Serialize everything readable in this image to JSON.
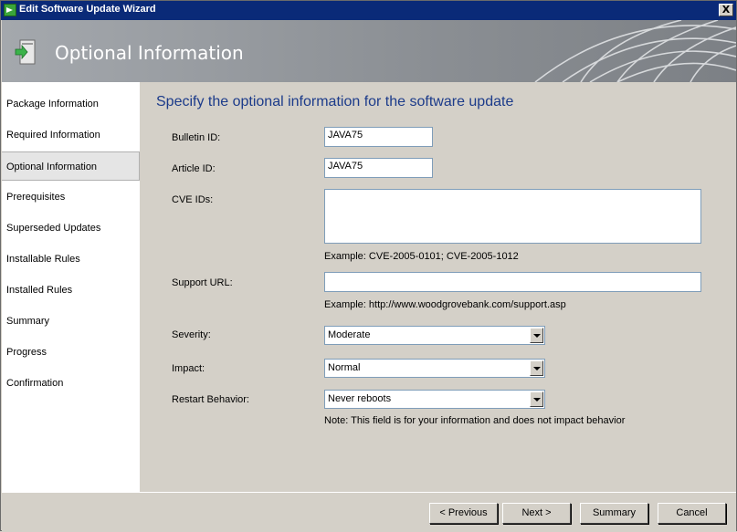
{
  "window": {
    "title": "Edit Software Update Wizard",
    "close_label": "X"
  },
  "banner": {
    "title": "Optional Information"
  },
  "nav": {
    "items": [
      {
        "label": "Package Information"
      },
      {
        "label": "Required Information"
      },
      {
        "label": "Optional Information",
        "active": true
      },
      {
        "label": "Prerequisites"
      },
      {
        "label": "Superseded Updates"
      },
      {
        "label": "Installable Rules"
      },
      {
        "label": "Installed Rules"
      },
      {
        "label": "Summary"
      },
      {
        "label": "Progress"
      },
      {
        "label": "Confirmation"
      }
    ]
  },
  "main": {
    "heading": "Specify the optional information for the software update",
    "bulletin": {
      "label": "Bulletin ID:",
      "value": "JAVA75"
    },
    "article": {
      "label": "Article ID:",
      "value": "JAVA75"
    },
    "cve": {
      "label": "CVE IDs:",
      "value": "",
      "example": "Example: CVE-2005-0101; CVE-2005-1012"
    },
    "support": {
      "label": "Support URL:",
      "value": "",
      "example": "Example: http://www.woodgrovebank.com/support.asp"
    },
    "severity": {
      "label": "Severity:",
      "value": "Moderate"
    },
    "impact": {
      "label": "Impact:",
      "value": "Normal"
    },
    "restart": {
      "label": "Restart Behavior:",
      "value": "Never reboots",
      "note": "Note: This field is for your information and does not impact behavior"
    }
  },
  "footer": {
    "previous": "< Previous",
    "next": "Next >",
    "summary": "Summary",
    "cancel": "Cancel"
  }
}
